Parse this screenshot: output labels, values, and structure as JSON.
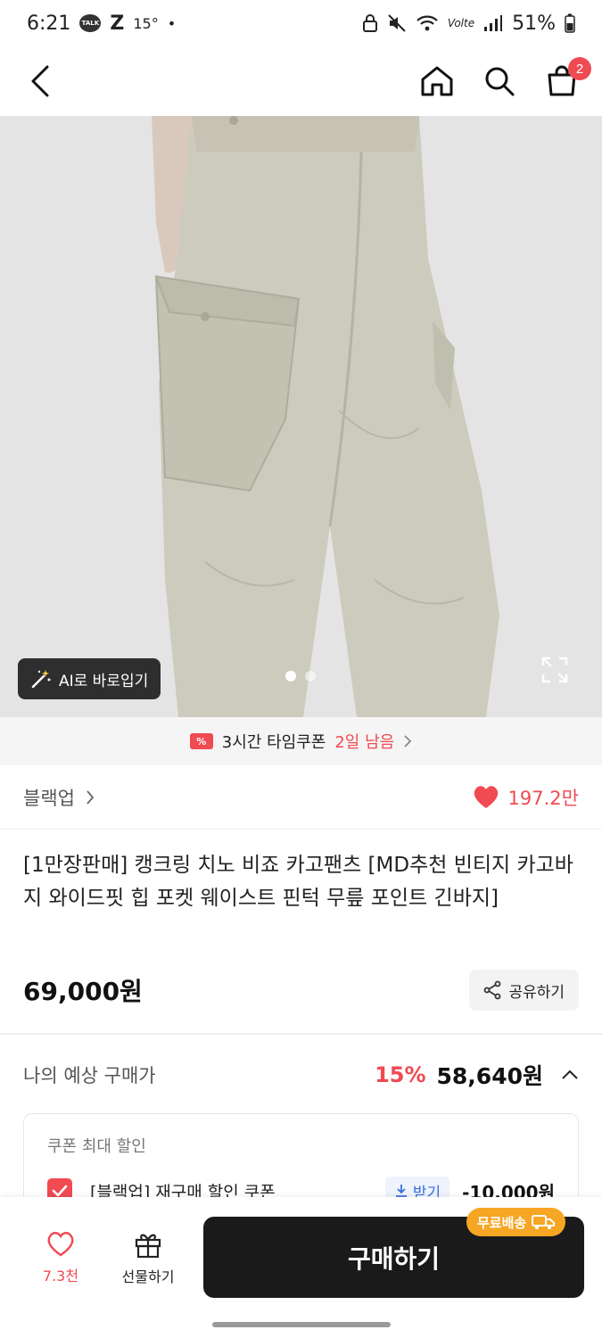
{
  "status_bar": {
    "time": "6:21",
    "talk_icon": "TALK",
    "z_icon": "Z",
    "temperature": "15°",
    "dot": "•",
    "signal_label": "Volte",
    "battery": "51%"
  },
  "header": {
    "cart_count": "2"
  },
  "hero": {
    "ai_button_label": "AI로 바로입기",
    "image_count": 2,
    "current_image": 1
  },
  "coupon_banner": {
    "text": "3시간 타임쿠폰",
    "remaining": "2일 남음"
  },
  "brand": {
    "name": "블랙업",
    "likes": "197.2만"
  },
  "product": {
    "title": "[1만장판매] 캥크링 치노 비죠 카고팬츠 [MD추천 빈티지 카고바지 와이드핏 힙 포켓 웨이스트 핀턱 무릎 포인트 긴바지]",
    "price": "69,000원",
    "share_label": "공유하기"
  },
  "expected": {
    "label": "나의 예상 구매가",
    "discount_rate": "15%",
    "price": "58,640원"
  },
  "coupon_box": {
    "title": "쿠폰 최대 할인",
    "coupon_name": "[블랙업] 재구매 할인 쿠폰",
    "get_label": "받기",
    "amount": "-10,000원"
  },
  "bottom_bar": {
    "fav_count": "7.3천",
    "gift_label": "선물하기",
    "buy_label": "구매하기",
    "free_shipping": "무료배송"
  },
  "colors": {
    "accent": "#f04a53",
    "primary_button": "#1a1a1a",
    "free_badge": "#f6a623",
    "link_blue": "#3b6fd8"
  }
}
